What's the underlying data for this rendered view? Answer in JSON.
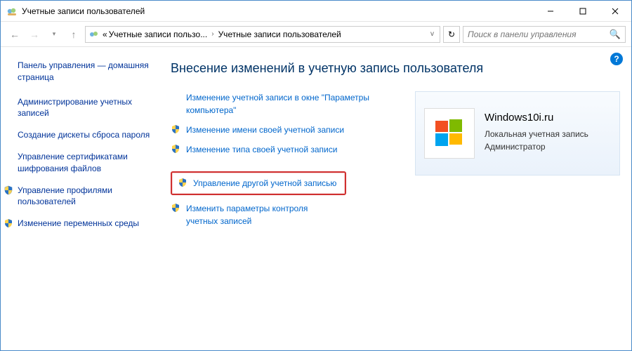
{
  "window": {
    "title": "Учетные записи пользователей"
  },
  "breadcrumb": {
    "prefix": "«",
    "seg1": "Учетные записи пользо...",
    "seg2": "Учетные записи пользователей"
  },
  "search": {
    "placeholder": "Поиск в панели управления"
  },
  "sidebar": {
    "home": "Панель управления — домашняя страница",
    "items": [
      {
        "label": "Администрирование учетных записей",
        "shield": false
      },
      {
        "label": "Создание дискеты сброса пароля",
        "shield": false
      },
      {
        "label": "Управление сертификатами шифрования файлов",
        "shield": false
      },
      {
        "label": "Управление профилями пользователей",
        "shield": true
      },
      {
        "label": "Изменение переменных среды",
        "shield": true
      }
    ]
  },
  "main": {
    "heading": "Внесение изменений в учетную запись пользователя",
    "links": [
      {
        "label": "Изменение учетной записи в окне \"Параметры компьютера\"",
        "shield": false,
        "hl": false
      },
      {
        "label": "Изменение имени своей учетной записи",
        "shield": true,
        "hl": false
      },
      {
        "label": "Изменение типа своей учетной записи",
        "shield": true,
        "hl": false
      },
      {
        "label": "Управление другой учетной записью",
        "shield": true,
        "hl": true
      },
      {
        "label": "Изменить параметры контроля учетных записей",
        "shield": true,
        "hl": false
      }
    ]
  },
  "user": {
    "name": "Windows10i.ru",
    "type": "Локальная учетная запись",
    "role": "Администратор"
  },
  "help": "?"
}
